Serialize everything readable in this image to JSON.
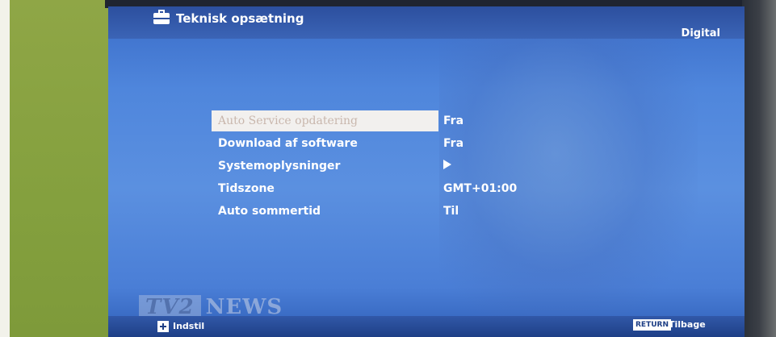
{
  "header": {
    "title": "Teknisk opsætning",
    "source": "Digital",
    "icon": "toolbox-icon"
  },
  "menu": {
    "items": [
      {
        "label": "Auto Service opdatering",
        "value": "Fra",
        "selected": true
      },
      {
        "label": "Download af software",
        "value": "Fra"
      },
      {
        "label": "Systemoplysninger",
        "value": "",
        "icon": "right-arrow-icon"
      },
      {
        "label": "Tidszone",
        "value": "GMT+01:00"
      },
      {
        "label": "Auto sommertid",
        "value": "Til"
      }
    ]
  },
  "overlay": {
    "channel_logo": "TV2",
    "channel_text": "NEWS"
  },
  "footer": {
    "left_label": "Indstil",
    "return_button": "RETURN",
    "right_label": "Tilbage"
  },
  "colors": {
    "menu_background": "#4f86dc",
    "header_background": "#2c4f9e",
    "selected_row": "#f2f0ee",
    "text": "#ffffff"
  }
}
